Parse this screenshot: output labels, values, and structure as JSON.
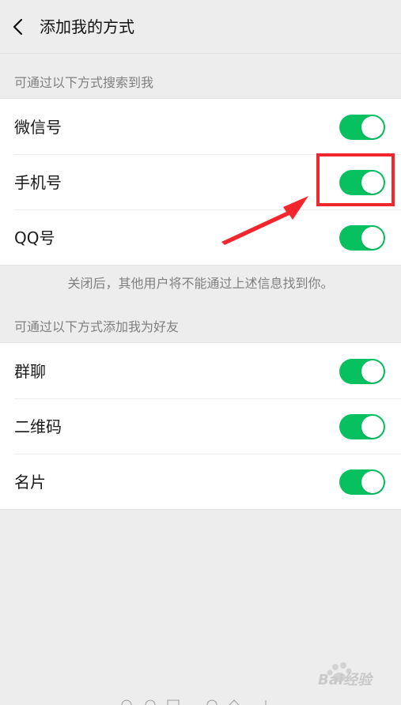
{
  "header": {
    "title": "添加我的方式",
    "back_icon": "chevron-left-icon"
  },
  "search_section": {
    "label": "可通过以下方式搜索到我",
    "items": [
      {
        "label": "微信号",
        "enabled": true
      },
      {
        "label": "手机号",
        "enabled": true
      },
      {
        "label": "QQ号",
        "enabled": true
      }
    ],
    "note": "关闭后，其他用户将不能通过上述信息找到你。"
  },
  "add_section": {
    "label": "可通过以下方式添加我为好友",
    "items": [
      {
        "label": "群聊",
        "enabled": true
      },
      {
        "label": "二维码",
        "enabled": true
      },
      {
        "label": "名片",
        "enabled": true
      }
    ]
  },
  "annotation": {
    "highlight_color": "#f2272d",
    "arrow_color": "#f2272d"
  },
  "watermark": {
    "logo": "paw-icon",
    "text": "Bai经验"
  },
  "colors": {
    "toggle_on": "#07c160",
    "background": "#ededed"
  }
}
